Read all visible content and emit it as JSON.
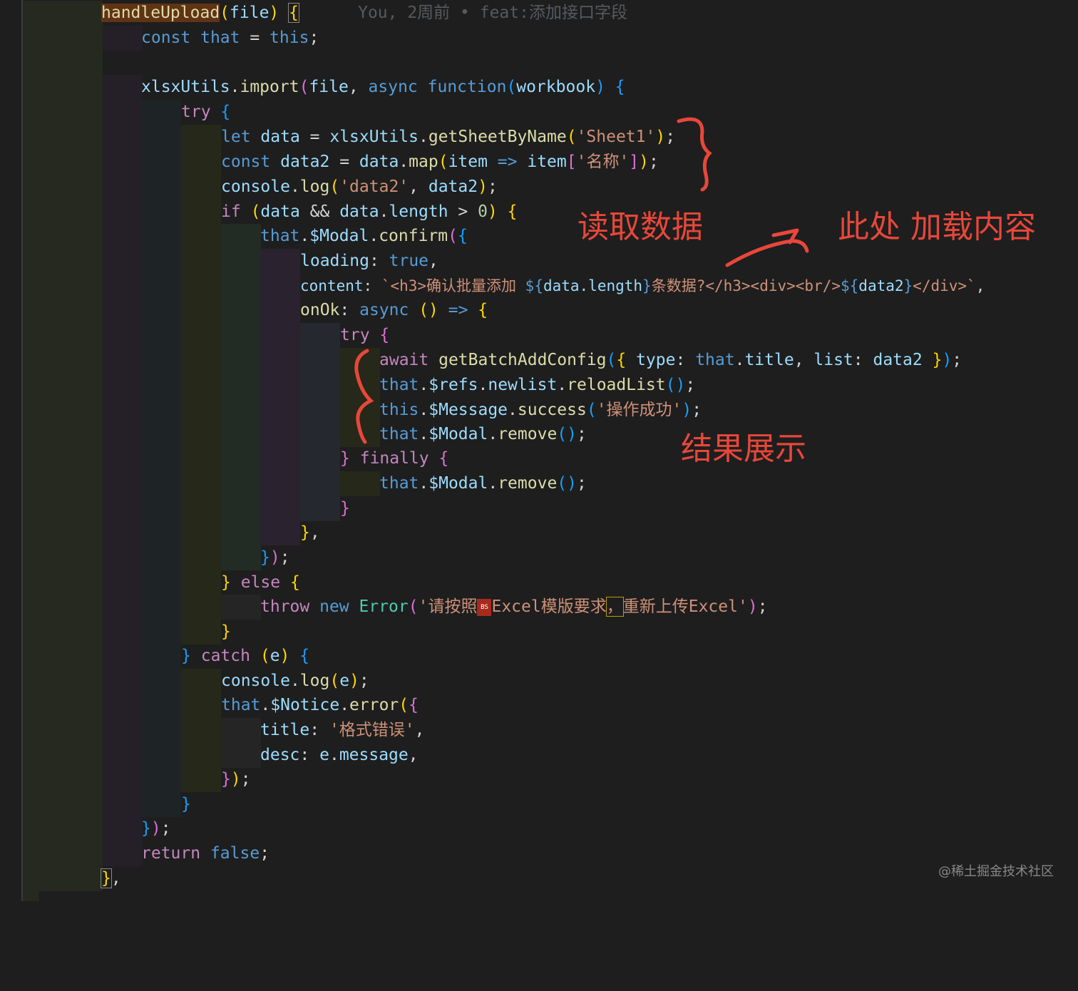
{
  "blame": "You, 2周前 • feat:添加接口字段",
  "annotations": {
    "read": "读取数据",
    "load": "此处 加载内容",
    "result": "结果展示"
  },
  "watermark": "@稀土掘金技术社区",
  "code": {
    "l1": {
      "fn": "handleUpload",
      "p1": "(",
      "arg": "file",
      "p2": ")",
      "brace": "{"
    },
    "l2": {
      "kw": "const",
      "name": "that",
      "eq": " = ",
      "val": "this",
      "end": ";"
    },
    "l4": {
      "obj": "xlsxUtils",
      "dot": ".",
      "method": "import",
      "p": "(",
      "arg": "file",
      "comma": ", ",
      "async": "async",
      "fn": "function",
      "p2": "(",
      "param": "workbook",
      "p3": ")",
      "brace": "{"
    },
    "l5": {
      "kw": "try",
      "brace": "{"
    },
    "l6": {
      "kw": "let",
      "name": "data",
      "eq": " = ",
      "obj": "xlsxUtils",
      "dot": ".",
      "method": "getSheetByName",
      "p": "(",
      "str": "'Sheet1'",
      "p2": ")",
      "end": ";"
    },
    "l7": {
      "kw": "const",
      "name": "data2",
      "eq": " = ",
      "obj": "data",
      "dot": ".",
      "method": "map",
      "p": "(",
      "item": "item",
      "arrow": " => ",
      "item2": "item",
      "b1": "[",
      "str": "'名称'",
      "b2": "]",
      "p2": ")",
      "end": ";"
    },
    "l8": {
      "obj": "console",
      "dot": ".",
      "method": "log",
      "p": "(",
      "str": "'data2'",
      "comma": ", ",
      "arg": "data2",
      "p2": ")",
      "end": ";"
    },
    "l9": {
      "kw": "if",
      "p": "(",
      "a": "data",
      "and": " && ",
      "b": "data",
      "dot": ".",
      "len": "length",
      "gt": " > ",
      "num": "0",
      "p2": ")",
      "brace": "{"
    },
    "l10": {
      "that": "that",
      "dot": ".",
      "modal": "$Modal",
      "dot2": ".",
      "method": "confirm",
      "p": "(",
      "brace": "{"
    },
    "l11": {
      "key": "loading",
      "colon": ": ",
      "val": "true",
      "comma": ","
    },
    "l12": {
      "key": "content",
      "colon": ": ",
      "tpl1": "`<h3>确认批量添加 ",
      "ex1o": "${",
      "ex1": "data.length",
      "ex1c": "}",
      "tpl2": "条数据?</h3><div><br/>",
      "ex2o": "${",
      "ex2": "data2",
      "ex2c": "}",
      "tpl3": "</div>`",
      "comma": ","
    },
    "l13": {
      "key": "onOk",
      "colon": ": ",
      "async": "async",
      "p": "()",
      "arrow": " => ",
      "brace": "{"
    },
    "l14": {
      "kw": "try",
      "brace": "{"
    },
    "l15": {
      "kw": "await",
      "fn": "getBatchAddConfig",
      "p": "(",
      "b": "{",
      "k1": " type",
      "c1": ": ",
      "that": "that",
      "dot": ".",
      "title": "title",
      "comma": ", ",
      "k2": "list",
      "c2": ": ",
      "data2": "data2",
      "bc": " }",
      "p2": ")",
      "end": ";"
    },
    "l16": {
      "that": "that",
      "dot": ".",
      "refs": "$refs",
      "dot2": ".",
      "newlist": "newlist",
      "dot3": ".",
      "method": "reloadList",
      "p": "()",
      "end": ";"
    },
    "l17": {
      "this": "this",
      "dot": ".",
      "msg": "$Message",
      "dot2": ".",
      "method": "success",
      "p": "(",
      "str": "'操作成功'",
      "p2": ")",
      "end": ";"
    },
    "l18": {
      "that": "that",
      "dot": ".",
      "modal": "$Modal",
      "dot2": ".",
      "method": "remove",
      "p": "()",
      "end": ";"
    },
    "l19": {
      "b": "}",
      "kw": "finally",
      "brace": "{"
    },
    "l20": {
      "that": "that",
      "dot": ".",
      "modal": "$Modal",
      "dot2": ".",
      "method": "remove",
      "p": "()",
      "end": ";"
    },
    "l21": {
      "b": "}"
    },
    "l22": {
      "b": "}",
      "comma": ","
    },
    "l23": {
      "b": "}",
      "p": ")",
      "end": ";"
    },
    "l24": {
      "b": "}",
      "kw": "else",
      "brace": "{"
    },
    "l25": {
      "kw": "throw",
      "kw2": "new",
      "cls": "Error",
      "p": "(",
      "str1": "'请按照",
      "badge": "BS",
      "str2": "Excel模版要求",
      "sel": "，",
      "str3": "重新上传Excel'",
      "p2": ")",
      "end": ";"
    },
    "l26": {
      "b": "}"
    },
    "l27": {
      "b": "}",
      "kw": "catch",
      "p": "(",
      "e": "e",
      "p2": ")",
      "brace": "{"
    },
    "l28": {
      "obj": "console",
      "dot": ".",
      "method": "log",
      "p": "(",
      "e": "e",
      "p2": ")",
      "end": ";"
    },
    "l29": {
      "that": "that",
      "dot": ".",
      "notice": "$Notice",
      "dot2": ".",
      "method": "error",
      "p": "(",
      "brace": "{"
    },
    "l30": {
      "key": "title",
      "colon": ": ",
      "str": "'格式错误'",
      "comma": ","
    },
    "l31": {
      "key": "desc",
      "colon": ": ",
      "e": "e",
      "dot": ".",
      "msg": "message",
      "comma": ","
    },
    "l32": {
      "b": "}",
      "p": ")",
      "end": ";"
    },
    "l33": {
      "b": "}"
    },
    "l34": {
      "b": "}",
      "p": ")",
      "end": ";"
    },
    "l35": {
      "kw": "return",
      "val": "false",
      "end": ";"
    },
    "l36": {
      "b": "}",
      "comma": ","
    },
    "l37": {
      "b": "}"
    }
  }
}
